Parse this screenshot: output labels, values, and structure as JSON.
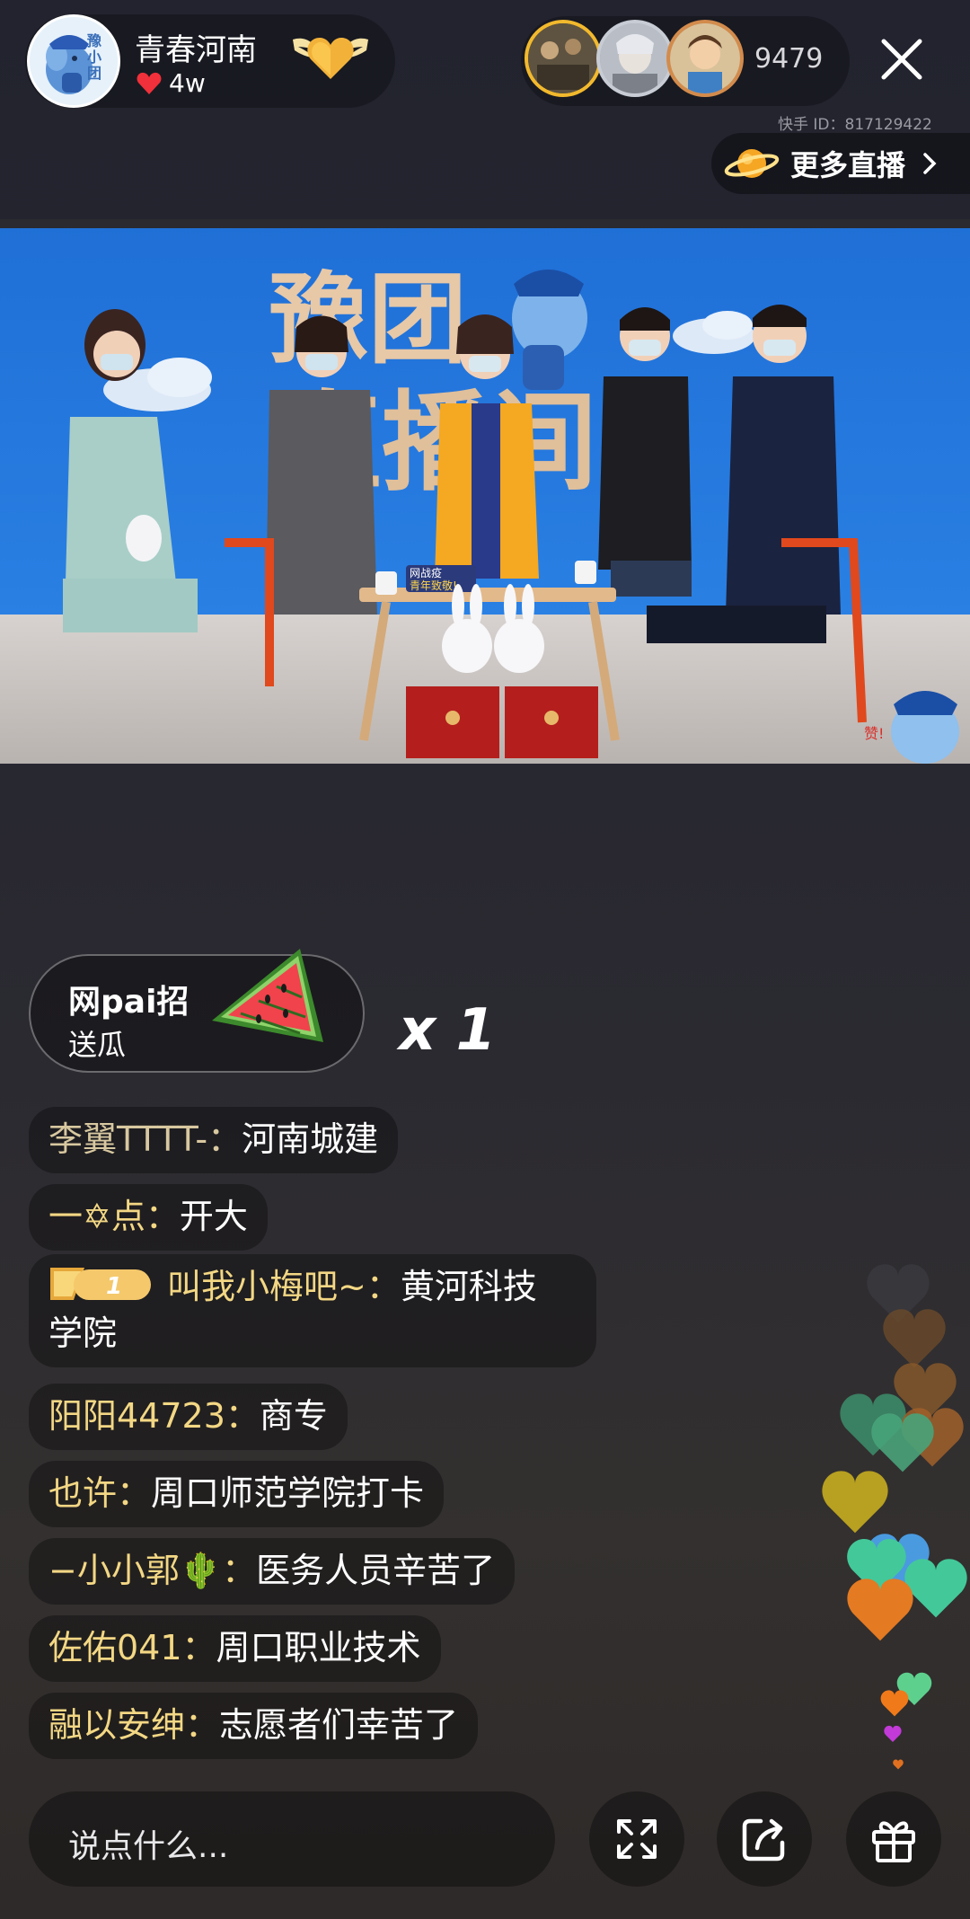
{
  "header": {
    "anchor_name": "青春河南",
    "likes": "4w",
    "avatar_text": "豫小团",
    "viewer_count": "9479",
    "kuaishou_id": "快手 ID：817129422",
    "more_live_label": "更多直播"
  },
  "video": {
    "backdrop_title_line1": "豫团",
    "backdrop_title_line2": "直播间",
    "table_sign_line1": "网战疫",
    "table_sign_line2": "青年致敬!",
    "corner_mascot_text": "赞!"
  },
  "gift_toast": {
    "user": "网pai招",
    "action": "送瓜",
    "count": "x 1"
  },
  "comments": [
    {
      "user": "李翼TTTT-：",
      "text": "河南城建"
    },
    {
      "user": "一✡点：",
      "text": "开大"
    },
    {
      "user": "叫我小梅吧~：",
      "text": "黄河科技",
      "text2": "学院",
      "level": "1"
    },
    {
      "user": "阳阳44723：",
      "text": "商专"
    },
    {
      "user": "也许：",
      "text": "周口师范学院打卡"
    },
    {
      "user": "−小小郭🌵：",
      "text": "医务人员辛苦了"
    },
    {
      "user": "佐佑041：",
      "text": "周口职业技术"
    },
    {
      "user": "融以安绅：",
      "text": "志愿者们幸苦了"
    }
  ],
  "bottom_bar": {
    "input_placeholder": "说点什么..."
  },
  "icons": {
    "close": "close-icon",
    "planet": "planet-icon",
    "heart": "heart-icon",
    "fullscreen": "fullscreen-icon",
    "share": "share-icon",
    "gift": "gift-icon"
  },
  "colors": {
    "username": "#f3d784",
    "heart_red": "#f0303a",
    "gold_badge": "#f2b23a"
  }
}
